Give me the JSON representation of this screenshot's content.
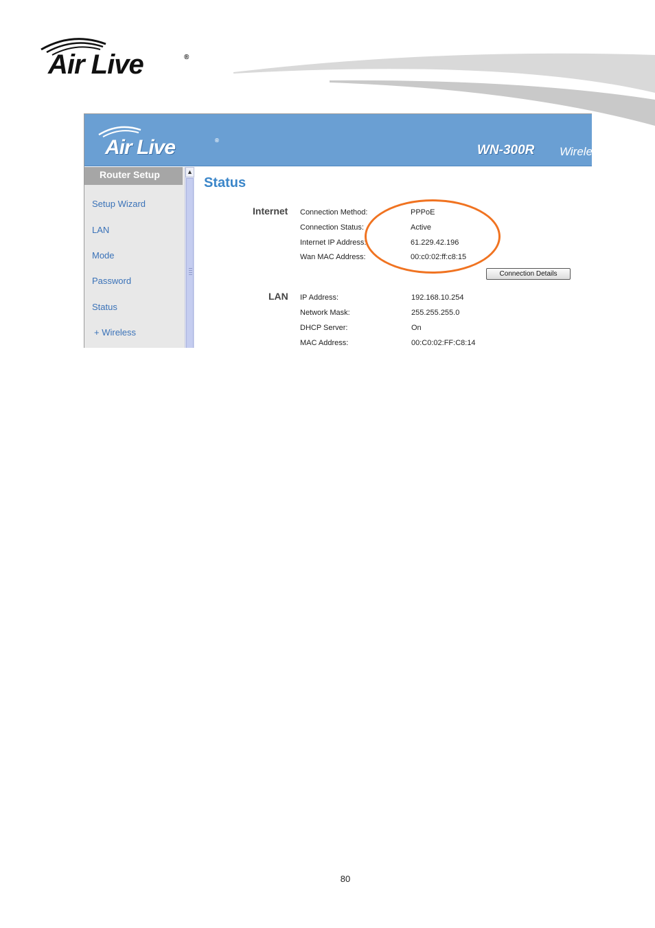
{
  "document": {
    "brand": {
      "word": "Air Live",
      "registered": "®"
    },
    "page_number": "80"
  },
  "screenshot": {
    "banner": {
      "brand": "Air Live",
      "registered": "®",
      "model": "WN-300R",
      "product_partial": "Wirele"
    },
    "sidebar": {
      "header": "Router Setup",
      "items": [
        {
          "label": "Setup Wizard"
        },
        {
          "label": "LAN"
        },
        {
          "label": "Mode"
        },
        {
          "label": "Password"
        },
        {
          "label": "Status"
        },
        {
          "label": "+ Wireless"
        }
      ]
    },
    "main": {
      "title": "Status",
      "internet": {
        "section": "Internet",
        "rows": [
          {
            "label": "Connection Method:",
            "value": "PPPoE"
          },
          {
            "label": "Connection Status:",
            "value": "Active"
          },
          {
            "label": "Internet IP Address:",
            "value": "61.229.42.196"
          },
          {
            "label": "Wan MAC Address:",
            "value": "00:c0:02:ff:c8:15"
          }
        ],
        "button": "Connection Details"
      },
      "lan": {
        "section": "LAN",
        "rows": [
          {
            "label": "IP Address:",
            "value": "192.168.10.254"
          },
          {
            "label": "Network Mask:",
            "value": "255.255.255.0"
          },
          {
            "label": "DHCP Server:",
            "value": "On"
          },
          {
            "label": "MAC Address:",
            "value": "00:C0:02:FF:C8:14"
          }
        ]
      }
    }
  },
  "colors": {
    "banner_blue": "#6a9fd3",
    "title_blue": "#3b86c9",
    "link_blue": "#3a72b8",
    "highlight_orange": "#f07321"
  }
}
